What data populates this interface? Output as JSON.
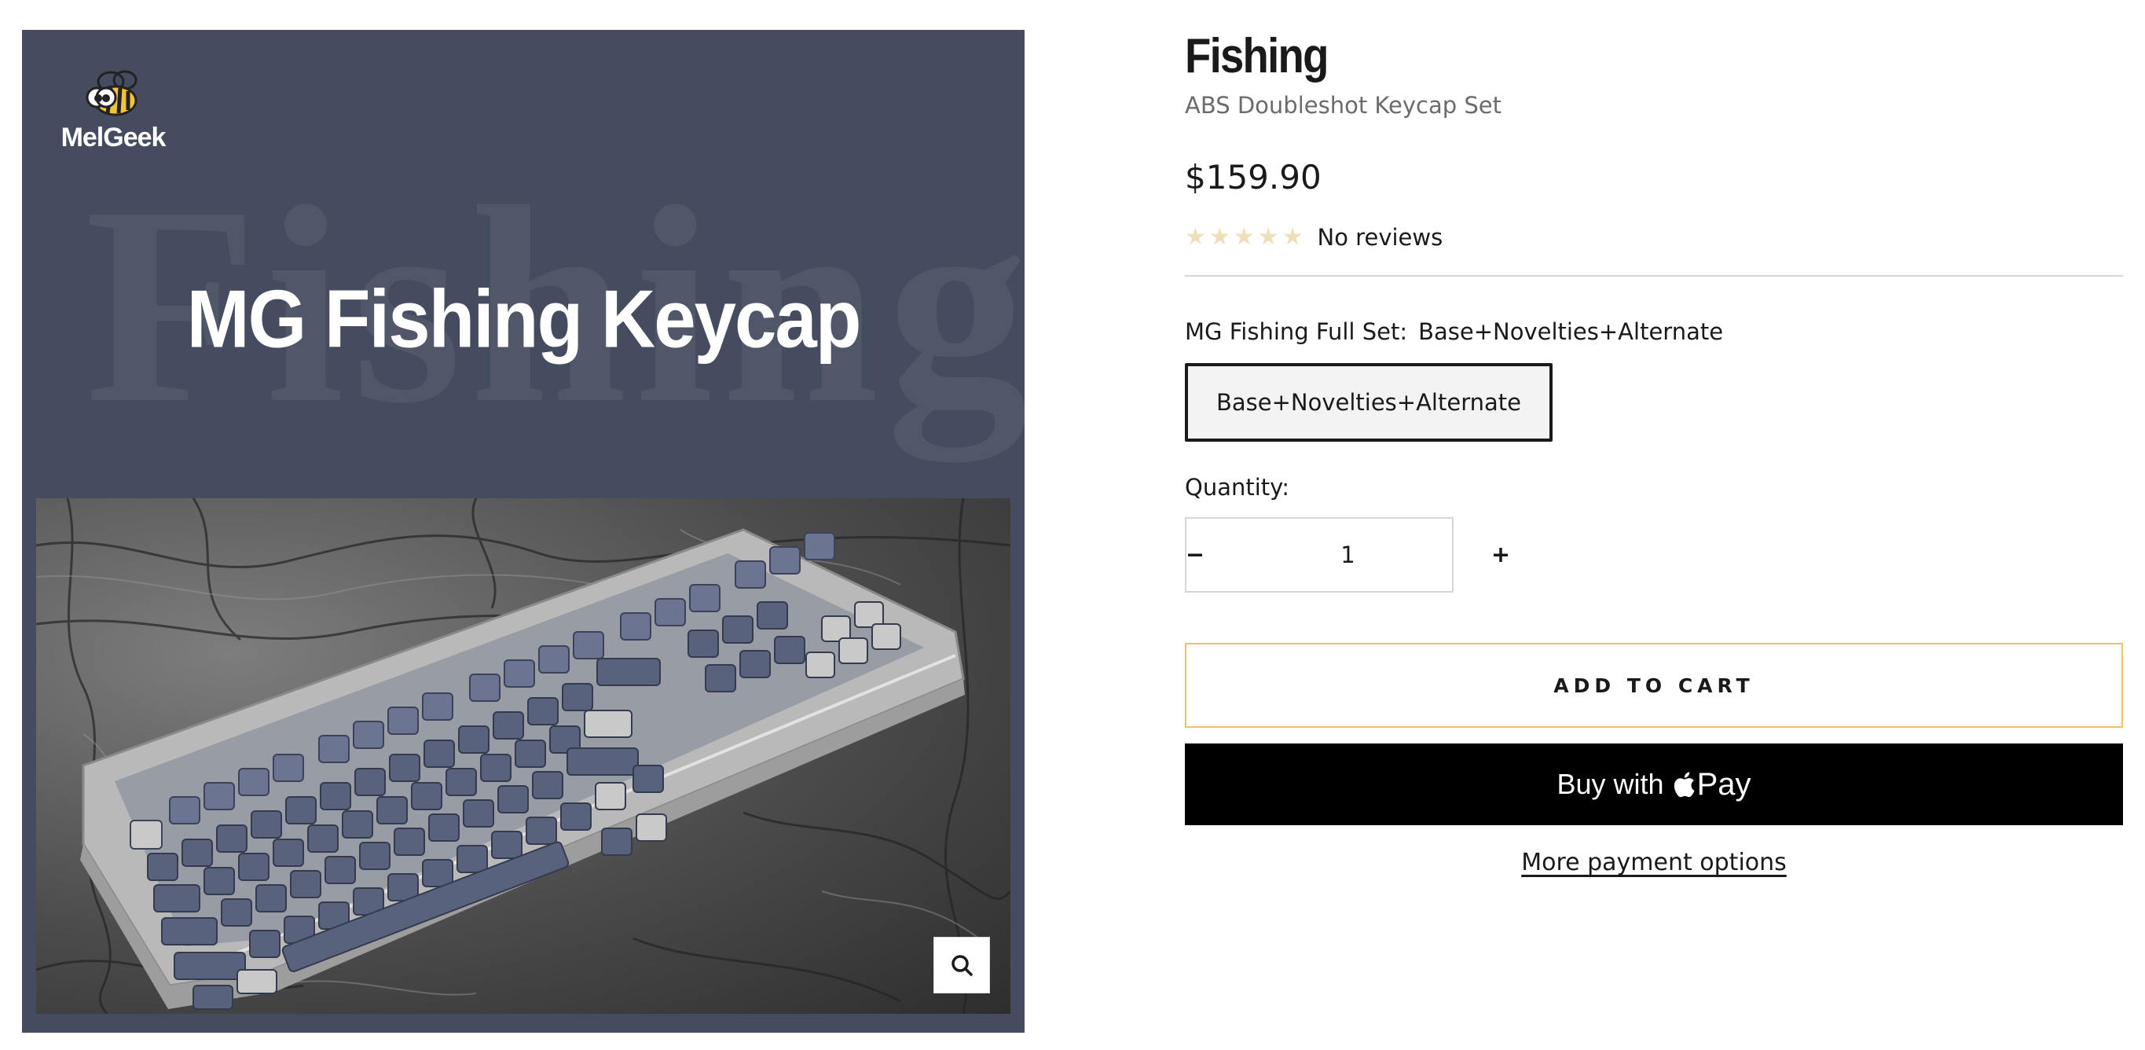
{
  "media": {
    "brand_name": "MelGeek",
    "background_word": "Fishing",
    "hero_title": "MG Fishing Keycap",
    "zoom_icon": "search-icon"
  },
  "product": {
    "title": "Fishing",
    "subtitle": "ABS Doubleshot Keycap Set",
    "price": "$159.90",
    "rating": {
      "stars_filled": 0,
      "stars_total": 5,
      "label": "No reviews",
      "star_color": "#efdfb8"
    },
    "variant": {
      "label": "MG Fishing Full Set:",
      "selected": "Base+Novelties+Alternate",
      "options": [
        "Base+Novelties+Alternate"
      ]
    },
    "quantity": {
      "label": "Quantity:",
      "value": "1",
      "decrease_icon": "minus-icon",
      "increase_icon": "plus-icon"
    },
    "add_to_cart_label": "ADD TO CART",
    "buy_now": {
      "prefix": "Buy with",
      "brand": "Pay"
    },
    "more_payment_label": "More payment options"
  },
  "colors": {
    "media_background": "#454c60",
    "add_to_cart_border": "#e8c467",
    "buy_now_background": "#000000"
  }
}
